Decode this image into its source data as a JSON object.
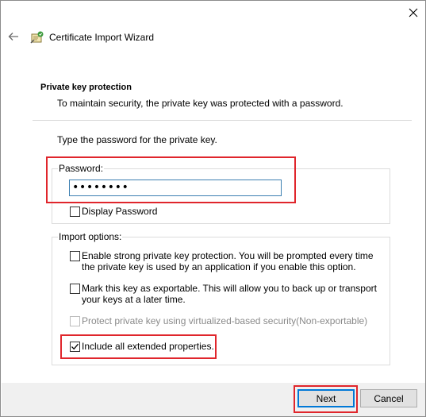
{
  "window": {
    "title": "Certificate Import Wizard"
  },
  "header": {
    "heading": "Private key protection",
    "description": "To maintain security, the private key was protected with a password."
  },
  "instruction": "Type the password for the private key.",
  "password_group": {
    "label": "Password:",
    "value": "••••••••",
    "display_password": {
      "label": "Display Password",
      "checked": false
    }
  },
  "import_options": {
    "label": "Import options:",
    "options": [
      {
        "label": "Enable strong private key protection. You will be prompted every time the private key is used by an application if you enable this option.",
        "checked": false,
        "enabled": true
      },
      {
        "label": "Mark this key as exportable. This will allow you to back up or transport your keys at a later time.",
        "checked": false,
        "enabled": true
      },
      {
        "label": "Protect private key using virtualized-based security(Non-exportable)",
        "checked": false,
        "enabled": false
      },
      {
        "label": "Include all extended properties.",
        "checked": true,
        "enabled": true
      }
    ]
  },
  "buttons": {
    "next": "Next",
    "cancel": "Cancel"
  },
  "icons": {
    "close": "close-icon",
    "back": "back-arrow-icon",
    "wizard": "certificate-icon"
  },
  "colors": {
    "highlight": "#e0262c",
    "focus_border": "#0078d7",
    "footer_bg": "#f0f0f0"
  }
}
